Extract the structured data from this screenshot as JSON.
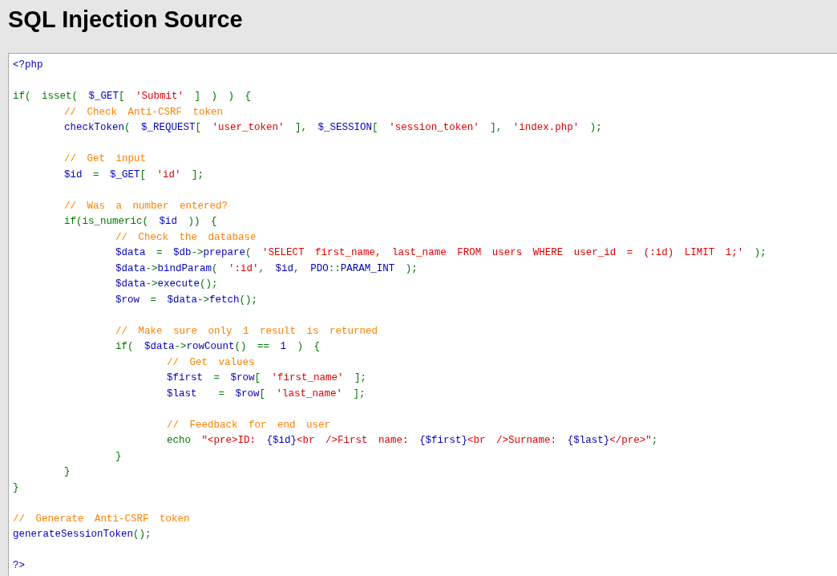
{
  "title": "SQL Injection Source",
  "code": {
    "blocks": [
      {
        "lines": [
          {
            "tokens": [
              {
                "kind": "default",
                "text": "<?php"
              }
            ]
          }
        ]
      },
      {
        "lines": [
          {
            "tokens": [
              {
                "kind": "keyword",
                "text": "if( isset( "
              },
              {
                "kind": "default",
                "text": "$_GET"
              },
              {
                "kind": "keyword",
                "text": "[ "
              },
              {
                "kind": "string",
                "text": "'Submit'"
              },
              {
                "kind": "keyword",
                "text": " ] ) ) {"
              }
            ]
          },
          {
            "tokens": [
              {
                "kind": "comment",
                "text": "\t// Check Anti-CSRF token"
              }
            ]
          },
          {
            "tokens": [
              {
                "kind": "default",
                "text": "\tcheckToken"
              },
              {
                "kind": "keyword",
                "text": "( "
              },
              {
                "kind": "default",
                "text": "$_REQUEST"
              },
              {
                "kind": "keyword",
                "text": "[ "
              },
              {
                "kind": "string",
                "text": "'user_token'"
              },
              {
                "kind": "keyword",
                "text": " ], "
              },
              {
                "kind": "default",
                "text": "$_SESSION"
              },
              {
                "kind": "keyword",
                "text": "[ "
              },
              {
                "kind": "string",
                "text": "'session_token'"
              },
              {
                "kind": "keyword",
                "text": " ], "
              },
              {
                "kind": "string",
                "text": "'index.php'"
              },
              {
                "kind": "keyword",
                "text": " );"
              }
            ]
          }
        ]
      },
      {
        "lines": [
          {
            "tokens": [
              {
                "kind": "comment",
                "text": "\t// Get input"
              }
            ]
          },
          {
            "tokens": [
              {
                "kind": "default",
                "text": "\t$id"
              },
              {
                "kind": "keyword",
                "text": " = "
              },
              {
                "kind": "default",
                "text": "$_GET"
              },
              {
                "kind": "keyword",
                "text": "[ "
              },
              {
                "kind": "string",
                "text": "'id'"
              },
              {
                "kind": "keyword",
                "text": " ];"
              }
            ]
          }
        ]
      },
      {
        "lines": [
          {
            "tokens": [
              {
                "kind": "comment",
                "text": "\t// Was a number entered?"
              }
            ]
          },
          {
            "tokens": [
              {
                "kind": "keyword",
                "text": "\tif(is_numeric( "
              },
              {
                "kind": "default",
                "text": "$id"
              },
              {
                "kind": "keyword",
                "text": " )) {"
              }
            ]
          },
          {
            "tokens": [
              {
                "kind": "comment",
                "text": "\t\t// Check the database"
              }
            ]
          },
          {
            "tokens": [
              {
                "kind": "default",
                "text": "\t\t$data"
              },
              {
                "kind": "keyword",
                "text": " = "
              },
              {
                "kind": "default",
                "text": "$db"
              },
              {
                "kind": "keyword",
                "text": "->"
              },
              {
                "kind": "default",
                "text": "prepare"
              },
              {
                "kind": "keyword",
                "text": "( "
              },
              {
                "kind": "string",
                "text": "'SELECT first_name, last_name FROM users WHERE user_id = (:id) LIMIT 1;'"
              },
              {
                "kind": "keyword",
                "text": " );"
              }
            ]
          },
          {
            "tokens": [
              {
                "kind": "default",
                "text": "\t\t$data"
              },
              {
                "kind": "keyword",
                "text": "->"
              },
              {
                "kind": "default",
                "text": "bindParam"
              },
              {
                "kind": "keyword",
                "text": "( "
              },
              {
                "kind": "string",
                "text": "':id'"
              },
              {
                "kind": "keyword",
                "text": ", "
              },
              {
                "kind": "default",
                "text": "$id"
              },
              {
                "kind": "keyword",
                "text": ", "
              },
              {
                "kind": "default",
                "text": "PDO"
              },
              {
                "kind": "keyword",
                "text": "::"
              },
              {
                "kind": "default",
                "text": "PARAM_INT"
              },
              {
                "kind": "keyword",
                "text": " );"
              }
            ]
          },
          {
            "tokens": [
              {
                "kind": "default",
                "text": "\t\t$data"
              },
              {
                "kind": "keyword",
                "text": "->"
              },
              {
                "kind": "default",
                "text": "execute"
              },
              {
                "kind": "keyword",
                "text": "();"
              }
            ]
          },
          {
            "tokens": [
              {
                "kind": "default",
                "text": "\t\t$row"
              },
              {
                "kind": "keyword",
                "text": " = "
              },
              {
                "kind": "default",
                "text": "$data"
              },
              {
                "kind": "keyword",
                "text": "->"
              },
              {
                "kind": "default",
                "text": "fetch"
              },
              {
                "kind": "keyword",
                "text": "();"
              }
            ]
          }
        ]
      },
      {
        "lines": [
          {
            "tokens": [
              {
                "kind": "comment",
                "text": "\t\t// Make sure only 1 result is returned"
              }
            ]
          },
          {
            "tokens": [
              {
                "kind": "keyword",
                "text": "\t\tif( "
              },
              {
                "kind": "default",
                "text": "$data"
              },
              {
                "kind": "keyword",
                "text": "->"
              },
              {
                "kind": "default",
                "text": "rowCount"
              },
              {
                "kind": "keyword",
                "text": "() == "
              },
              {
                "kind": "default",
                "text": "1"
              },
              {
                "kind": "keyword",
                "text": " ) {"
              }
            ]
          },
          {
            "tokens": [
              {
                "kind": "comment",
                "text": "\t\t\t// Get values"
              }
            ]
          },
          {
            "tokens": [
              {
                "kind": "default",
                "text": "\t\t\t$first"
              },
              {
                "kind": "keyword",
                "text": " = "
              },
              {
                "kind": "default",
                "text": "$row"
              },
              {
                "kind": "keyword",
                "text": "[ "
              },
              {
                "kind": "string",
                "text": "'first_name'"
              },
              {
                "kind": "keyword",
                "text": " ];"
              }
            ]
          },
          {
            "tokens": [
              {
                "kind": "default",
                "text": "\t\t\t$last"
              },
              {
                "kind": "keyword",
                "text": "  = "
              },
              {
                "kind": "default",
                "text": "$row"
              },
              {
                "kind": "keyword",
                "text": "[ "
              },
              {
                "kind": "string",
                "text": "'last_name'"
              },
              {
                "kind": "keyword",
                "text": " ];"
              }
            ]
          }
        ]
      },
      {
        "lines": [
          {
            "tokens": [
              {
                "kind": "comment",
                "text": "\t\t\t// Feedback for end user"
              }
            ]
          },
          {
            "tokens": [
              {
                "kind": "keyword",
                "text": "\t\t\techo "
              },
              {
                "kind": "string",
                "text": "\"<pre>ID: "
              },
              {
                "kind": "default",
                "text": "{$id}"
              },
              {
                "kind": "string",
                "text": "<br />First name: "
              },
              {
                "kind": "default",
                "text": "{$first}"
              },
              {
                "kind": "string",
                "text": "<br />Surname: "
              },
              {
                "kind": "default",
                "text": "{$last}"
              },
              {
                "kind": "string",
                "text": "</pre>\""
              },
              {
                "kind": "keyword",
                "text": ";"
              }
            ]
          },
          {
            "tokens": [
              {
                "kind": "keyword",
                "text": "\t\t}"
              }
            ]
          },
          {
            "tokens": [
              {
                "kind": "keyword",
                "text": "\t}"
              }
            ]
          },
          {
            "tokens": [
              {
                "kind": "keyword",
                "text": "}"
              }
            ]
          }
        ]
      },
      {
        "lines": [
          {
            "tokens": [
              {
                "kind": "comment",
                "text": "// Generate Anti-CSRF token"
              }
            ]
          },
          {
            "tokens": [
              {
                "kind": "default",
                "text": "generateSessionToken"
              },
              {
                "kind": "keyword",
                "text": "();"
              }
            ]
          }
        ]
      },
      {
        "lines": [
          {
            "tokens": [
              {
                "kind": "default",
                "text": "?>"
              }
            ]
          }
        ]
      }
    ]
  }
}
